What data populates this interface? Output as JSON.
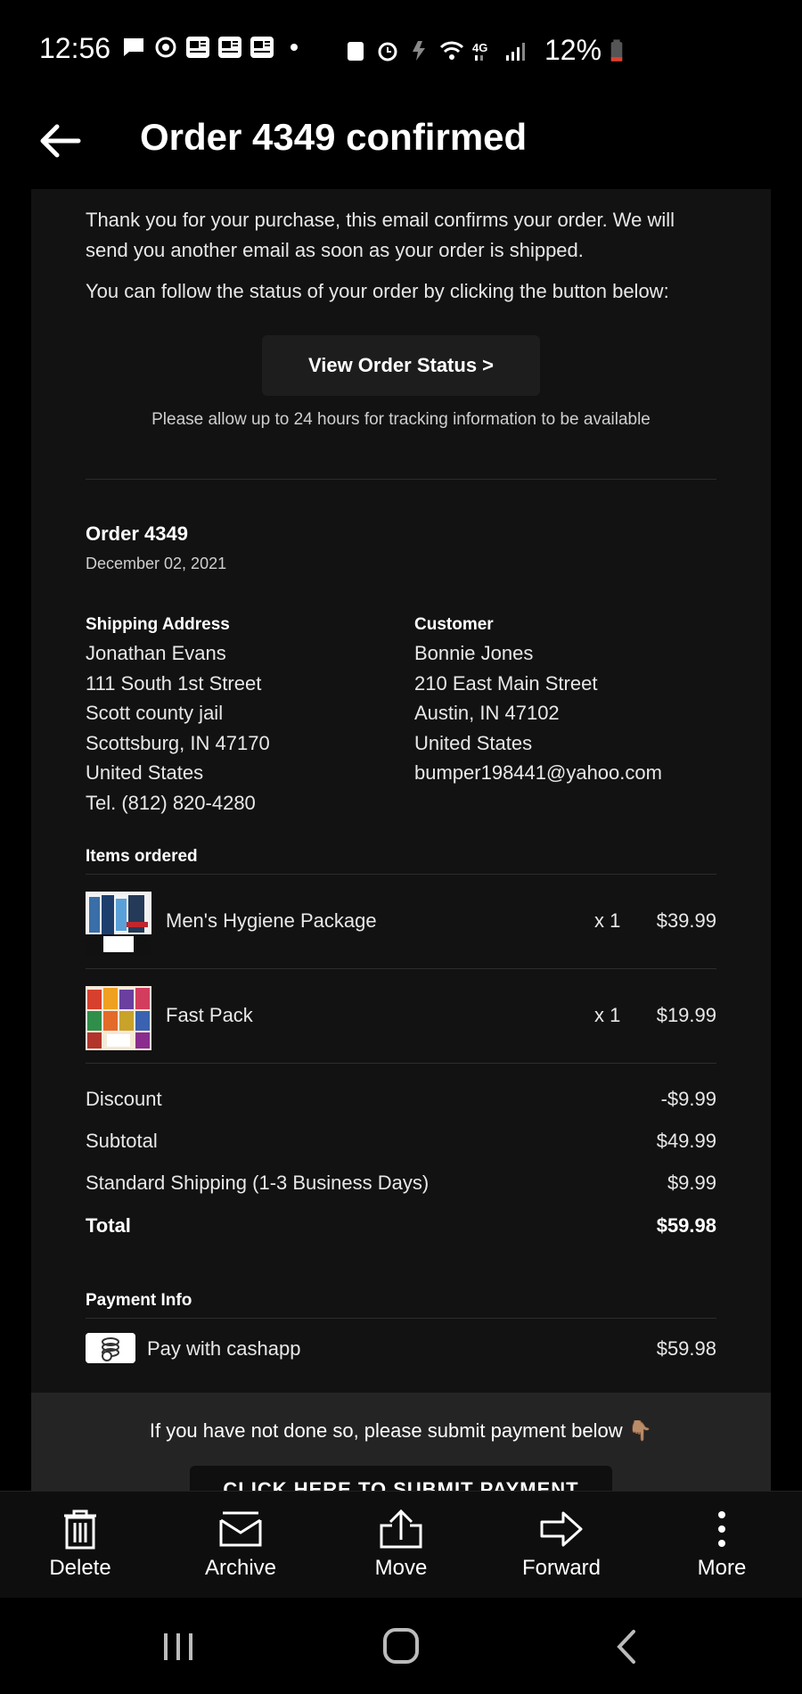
{
  "status_bar": {
    "time": "12:56",
    "battery": "12%",
    "icons": [
      "message-icon",
      "sync-icon",
      "news-icon",
      "news-icon",
      "news-icon",
      "dot-icon",
      "recycle-icon",
      "alarm-icon",
      "charging-icon",
      "wifi-icon",
      "4g-lte-icon",
      "signal-icon",
      "battery-icon"
    ]
  },
  "header": {
    "title": "Order 4349 confirmed"
  },
  "email": {
    "intro": "Thank you for your purchase, this email confirms your order. We will send you another email as soon as your order is shipped.",
    "follow": "You can follow the status of your order by clicking the button below:",
    "view_status_button": "View Order Status >",
    "tracking_note": "Please allow up to 24 hours for tracking information to be available",
    "order_title": "Order 4349",
    "order_date": "December 02, 2021",
    "shipping": {
      "heading": "Shipping Address",
      "lines": [
        "Jonathan Evans",
        "111 South 1st Street",
        "Scott county jail",
        "Scottsburg, IN 47170",
        "United States",
        "Tel. (812) 820-4280"
      ]
    },
    "customer": {
      "heading": "Customer",
      "lines": [
        "Bonnie Jones",
        "210 East Main Street",
        "Austin, IN 47102",
        "United States",
        "bumper198441@yahoo.com"
      ]
    },
    "items_heading": "Items ordered",
    "items": [
      {
        "name": "Men's Hygiene Package",
        "qty": "x 1",
        "price": "$39.99"
      },
      {
        "name": "Fast Pack",
        "qty": "x 1",
        "price": "$19.99"
      }
    ],
    "summary": {
      "discount_label": "Discount",
      "discount_value": "-$9.99",
      "subtotal_label": "Subtotal",
      "subtotal_value": "$49.99",
      "shipping_label": "Standard Shipping (1-3 Business Days)",
      "shipping_value": "$9.99",
      "total_label": "Total",
      "total_value": "$59.98"
    },
    "payment": {
      "heading": "Payment Info",
      "method": "Pay with cashapp",
      "amount": "$59.98"
    },
    "submit_note": "If you have not done so, please submit payment below 👇🏽",
    "submit_button": "CLICK HERE TO SUBMIT PAYMENT"
  },
  "toolbar": {
    "delete": "Delete",
    "archive": "Archive",
    "move": "Move",
    "forward": "Forward",
    "more": "More"
  }
}
